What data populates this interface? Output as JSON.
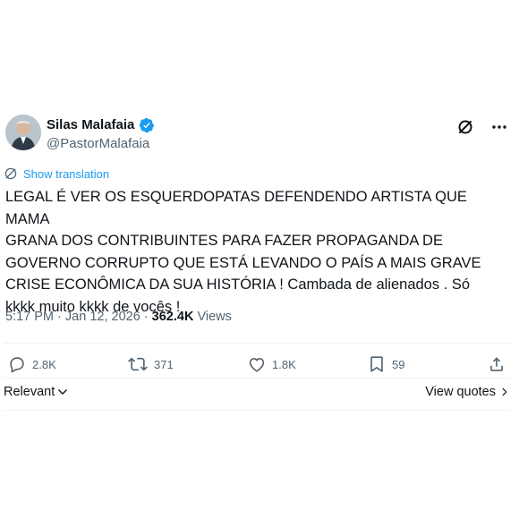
{
  "author": {
    "display_name": "Silas Malafaia",
    "handle": "@PastorMalafaia",
    "verified": true
  },
  "header_actions": {
    "grok_icon": "grok-icon",
    "more_icon": "more-icon"
  },
  "translate": {
    "label": "Show translation"
  },
  "tweet": {
    "text": "LEGAL É VER OS ESQUERDOPATAS DEFENDENDO ARTISTA QUE MAMA\nGRANA DOS CONTRIBUINTES PARA FAZER PROPAGANDA DE\nGOVERNO CORRUPTO QUE ESTÁ LEVANDO O PAÍS A MAIS GRAVE\nCRISE ECONÔMICA DA SUA HISTÓRIA ! Cambada de alienados . Só\nkkkk muito kkkk de vocês !",
    "time": "5:17 PM",
    "separator": "·",
    "date": "Jan 12, 2026",
    "views_count": "362.4K",
    "views_label": "Views"
  },
  "actions": {
    "replies": "2.8K",
    "reposts": "371",
    "likes": "1.8K",
    "bookmarks": "59"
  },
  "sort": {
    "label": "Relevant"
  },
  "view_quotes": {
    "label": "View quotes"
  },
  "colors": {
    "accent": "#1d9bf0",
    "text": "#0f1419",
    "secondary": "#536471",
    "divider": "#eff3f4"
  }
}
